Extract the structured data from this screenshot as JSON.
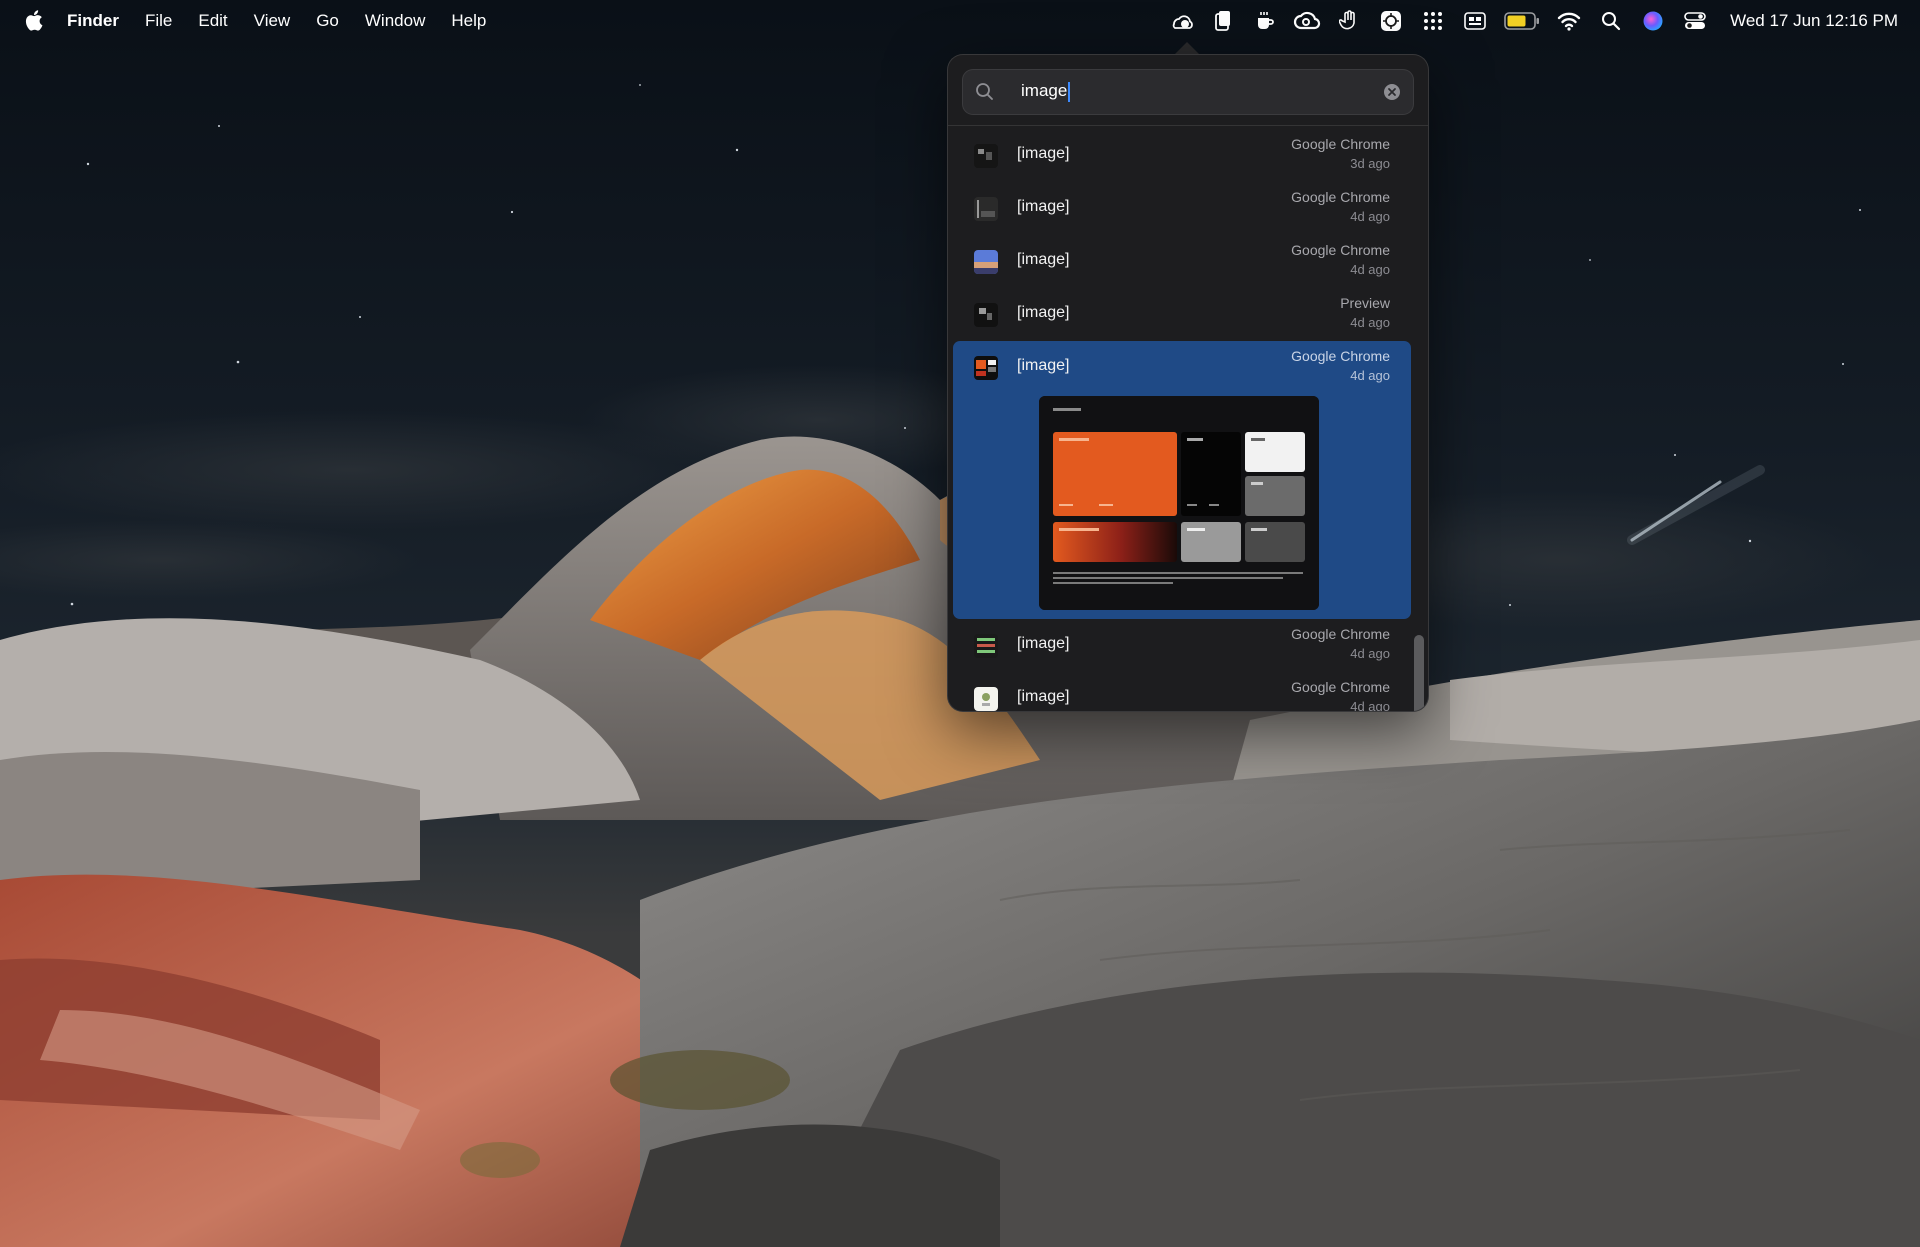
{
  "menubar": {
    "app_name": "Finder",
    "menus": [
      "File",
      "Edit",
      "View",
      "Go",
      "Window",
      "Help"
    ],
    "tray_icons": [
      "weather-icon",
      "clipboard-icon",
      "coffee-icon",
      "creative-cloud-icon",
      "hand-icon",
      "screenshot-icon",
      "grid-icon",
      "keyboard-layout-icon",
      "battery-icon",
      "wifi-icon",
      "spotlight-icon",
      "siri-icon",
      "control-center-icon"
    ],
    "battery_color": "#f2d024",
    "clock": "Wed 17 Jun  12:16 PM"
  },
  "clipboard": {
    "search": {
      "value": "image",
      "placeholder": ""
    },
    "items": [
      {
        "label": "[image]",
        "source": "Google Chrome",
        "time": "3d ago",
        "selected": false
      },
      {
        "label": "[image]",
        "source": "Google Chrome",
        "time": "4d ago",
        "selected": false
      },
      {
        "label": "[image]",
        "source": "Google Chrome",
        "time": "4d ago",
        "selected": false
      },
      {
        "label": "[image]",
        "source": "Preview",
        "time": "4d ago",
        "selected": false
      },
      {
        "label": "[image]",
        "source": "Google Chrome",
        "time": "4d ago",
        "selected": true
      },
      {
        "label": "[image]",
        "source": "Google Chrome",
        "time": "4d ago",
        "selected": false
      },
      {
        "label": "[image]",
        "source": "Google Chrome",
        "time": "4d ago",
        "selected": false
      }
    ],
    "accent_color": "#1f4a86",
    "preview_colors": {
      "orange": "#e35a1f",
      "dark": "#0d0d0d",
      "white": "#f2f2f2",
      "grey": "#6b6b6b",
      "light_grey": "#9a9a9a"
    }
  }
}
